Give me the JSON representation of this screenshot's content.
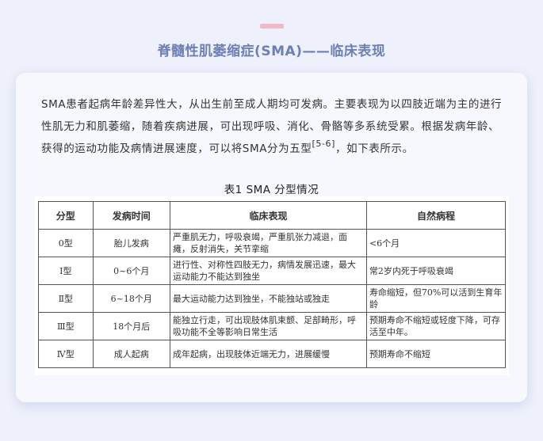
{
  "header": {
    "title": "脊髓性肌萎缩症(SMA)——临床表现"
  },
  "intro": {
    "paragraph": "SMA患者起病年龄差异性大，从出生前至成人期均可发病。主要表现为以四肢近端为主的进行性肌无力和肌萎缩，随着疾病进展，可出现呼吸、消化、骨骼等多系统受累。根据发病年龄、获得的运动功能及病情进展速度，可以将SMA分为五型",
    "citation": "[5-6]",
    "ending": "，如下表所示。"
  },
  "table": {
    "caption": "表1 SMA 分型情况",
    "headers": [
      "分型",
      "发病时间",
      "临床表现",
      "自然病程"
    ],
    "rows": [
      [
        "0型",
        "胎儿发病",
        "严重肌无力，呼吸衰竭，严重肌张力减退，面瘫，反射消失，关节挛缩",
        "<6个月"
      ],
      [
        "Ⅰ型",
        "0~6个月",
        "进行性、对称性四肢无力，病情发展迅速，最大运动能力不能达到独坐",
        "常2岁内死于呼吸衰竭"
      ],
      [
        "Ⅱ型",
        "6~18个月",
        "最大运动能力达到独坐，不能独站或独走",
        "寿命缩短，但70%可以活到生育年龄"
      ],
      [
        "Ⅲ型",
        "18个月后",
        "能独立行走，可出现肢体肌束颤、足部畸形，呼吸功能不全等影响日常生活",
        "预期寿命不缩短或轻度下降，可存活至中年。"
      ],
      [
        "Ⅳ型",
        "成人起病",
        "成年起病，出现肢体近端无力，进展缓慢",
        "预期寿命不缩短"
      ]
    ]
  },
  "colors": {
    "accent": "#f2b8c6",
    "title": "#6d7fb4",
    "card": "#f7f8fe",
    "background": "#eef1fb"
  }
}
